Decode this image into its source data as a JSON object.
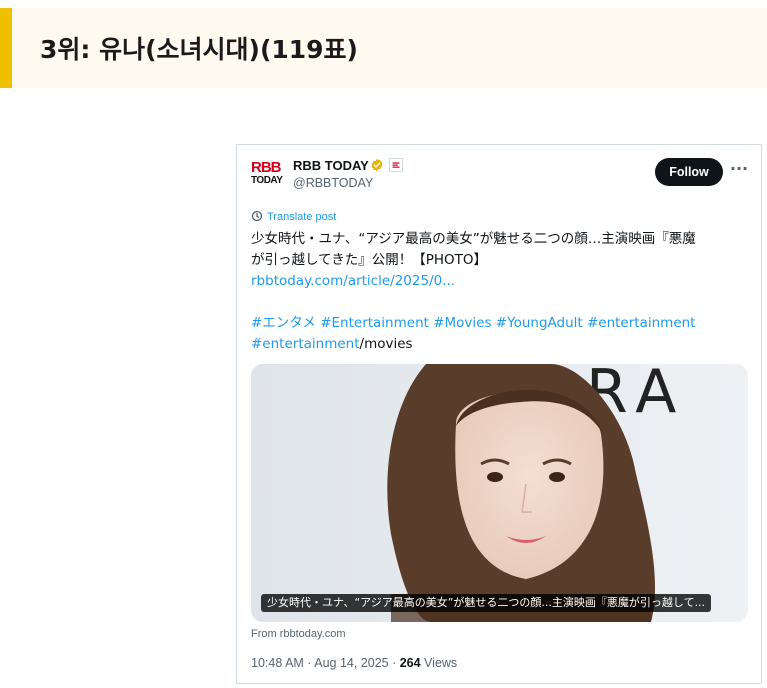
{
  "header": {
    "title": "3위: 유나(소녀시대)(119표)"
  },
  "tweet": {
    "logo_top": "RBB",
    "logo_bottom": "TODAY",
    "display_name": "RBB TODAY",
    "handle": "@RBBTODAY",
    "follow_label": "Follow",
    "more_label": "···",
    "translate_label": "Translate post",
    "text_line1": "少女時代・ユナ、“アジア最高の美女”が魅せる二つの顔…主演映画『悪魔",
    "text_line2": "が引っ越してきた』公開！【PHOTO】",
    "link": "rbbtoday.com/article/2025/0...",
    "hashtags_line1": "#エンタメ #Entertainment #Movies #YoungAdult #entertainment",
    "hashtag_line2": "#entertainment",
    "hashtag_line2_suffix": "/movies",
    "media_caption": "少女時代・ユナ、“アジア最高の美女”が魅せる二つの顔...主演映画『悪魔が引っ越して...",
    "source": "From rbbtoday.com",
    "timestamp": "10:48 AM · Aug 14, 2025 · ",
    "views_count": "264",
    "views_label": " Views"
  },
  "icons": [
    "verified-badge-icon",
    "affiliate-badge-icon",
    "translate-icon",
    "more-icon"
  ],
  "colors": {
    "accent": "#f0c000",
    "link": "#1d9bf0",
    "follow_bg": "#0f1419",
    "verified": "#e8b50e"
  }
}
